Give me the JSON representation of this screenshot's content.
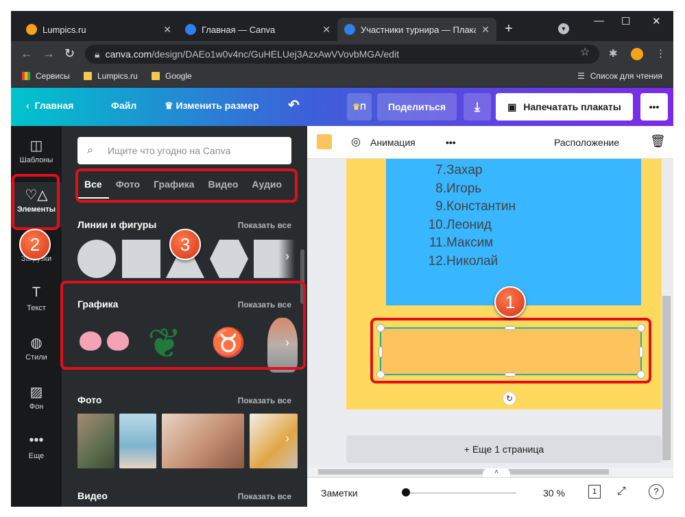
{
  "browser": {
    "tabs": [
      {
        "title": "Lumpics.ru",
        "favicon": "orange-circle-icon"
      },
      {
        "title": "Главная — Canva",
        "favicon": "canva-icon"
      },
      {
        "title": "Участники турнира — Плакат",
        "favicon": "canva-icon"
      }
    ],
    "new_tab": "+",
    "url_domain": "canva.com",
    "url_path": "/design/DAEo1w0v4nc/GuHELUej3AzxAwVVovbMGA/edit",
    "bookmarks": [
      {
        "label": "Сервисы",
        "icon": "apps-grid-icon"
      },
      {
        "label": "Lumpics.ru",
        "icon": "folder-icon"
      },
      {
        "label": "Google",
        "icon": "folder-icon"
      }
    ],
    "reading_list": "Список для чтения"
  },
  "header": {
    "home": "Главная",
    "file": "Файл",
    "resize": "Изменить размер",
    "pro": "П",
    "share": "Поделиться",
    "print": "Напечатать плакаты",
    "more": "•••"
  },
  "sidebar": {
    "items": [
      {
        "label": "Шаблоны",
        "icon": "templates-icon"
      },
      {
        "label": "Элементы",
        "icon": "elements-icon"
      },
      {
        "label": "Загрузки",
        "icon": "uploads-icon"
      },
      {
        "label": "Текст",
        "icon": "text-icon"
      },
      {
        "label": "Стили",
        "icon": "palette-icon"
      },
      {
        "label": "Фон",
        "icon": "background-icon"
      },
      {
        "label": "Еще",
        "icon": "more-icon"
      }
    ]
  },
  "panel": {
    "search_placeholder": "Ищите что угодно на Canva",
    "filters": [
      "Все",
      "Фото",
      "Графика",
      "Видео",
      "Аудио"
    ],
    "sections": [
      {
        "title": "Линии и фигуры",
        "show_all": "Показать все"
      },
      {
        "title": "Графика",
        "show_all": "Показать все"
      },
      {
        "title": "Фото",
        "show_all": "Показать все"
      },
      {
        "title": "Видео",
        "show_all": "Показать все"
      }
    ]
  },
  "toolbar": {
    "color": "#ffc35e",
    "animation": "Анимация",
    "more": "•••",
    "position": "Расположение"
  },
  "canvas": {
    "list": [
      {
        "num": "7.",
        "name": "Захар"
      },
      {
        "num": "8.",
        "name": "Игорь"
      },
      {
        "num": "9.",
        "name": "Константин"
      },
      {
        "num": "10.",
        "name": "Леонид"
      },
      {
        "num": "11.",
        "name": "Максим"
      },
      {
        "num": "12.",
        "name": "Николай"
      }
    ],
    "add_page": "+ Еще 1 страница"
  },
  "footer": {
    "notes": "Заметки",
    "zoom": "30 %",
    "page_count": "1"
  },
  "annotations": [
    "1",
    "2",
    "3"
  ]
}
